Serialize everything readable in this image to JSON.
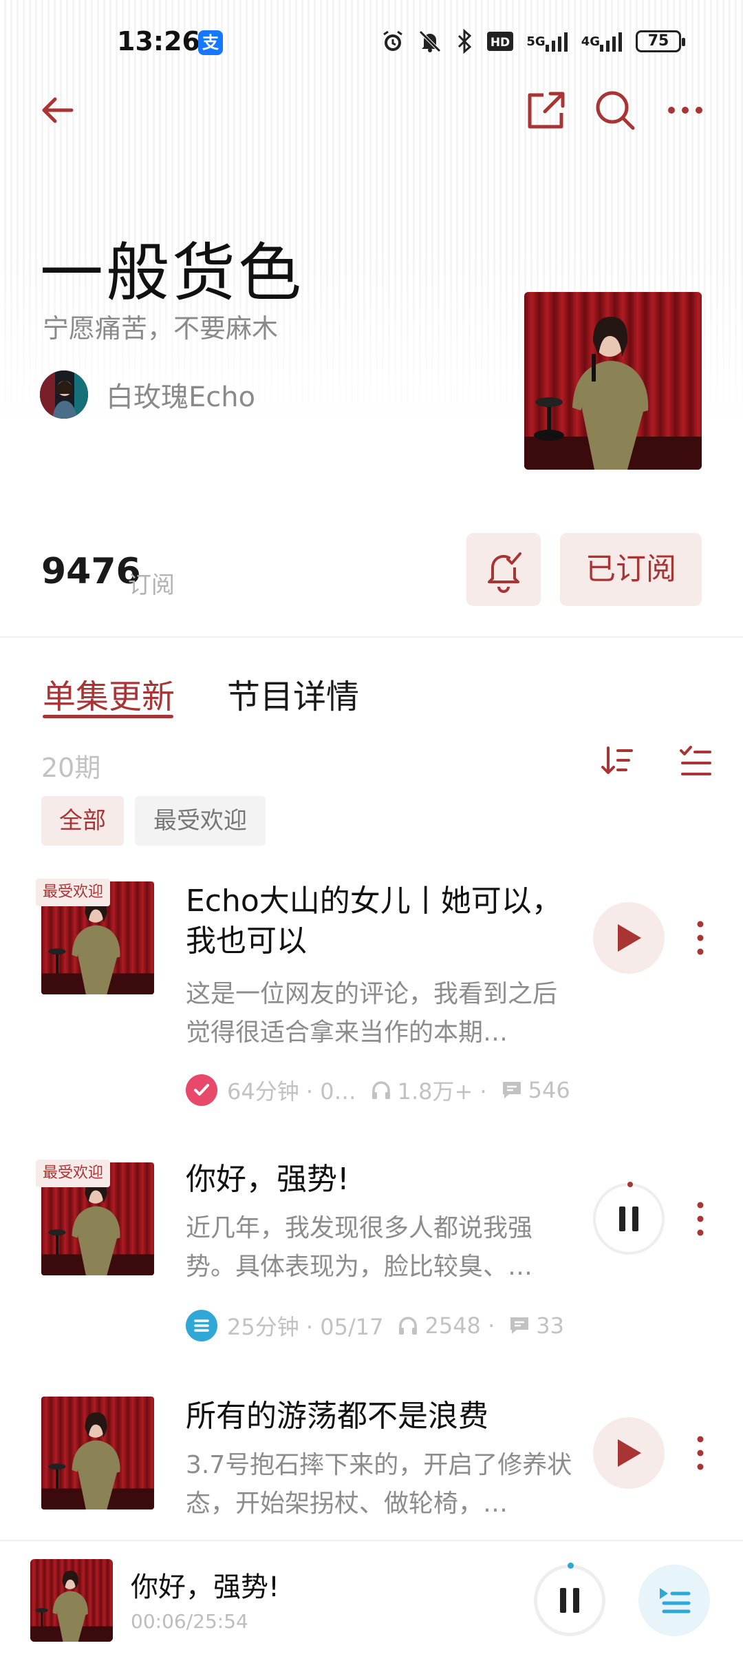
{
  "status_bar": {
    "time": "13:26",
    "alipay_glyph": "支",
    "network_5g": "5G",
    "network_4g": "4G",
    "hd_label": "HD",
    "battery": "75"
  },
  "podcast": {
    "title": "一般货色",
    "subtitle": "宁愿痛苦，不要麻木",
    "author": "白玫瑰Echo",
    "subscriber_count": "9476",
    "subscriber_label": "订阅",
    "subscribed_label": "已订阅"
  },
  "tabs": [
    {
      "label": "单集更新",
      "active": true
    },
    {
      "label": "节目详情",
      "active": false
    }
  ],
  "episode_count": "20期",
  "filters": [
    {
      "label": "全部",
      "active": true
    },
    {
      "label": "最受欢迎",
      "active": false
    }
  ],
  "episodes": [
    {
      "badge": "最受欢迎",
      "title": "Echo大山的女儿丨她可以，我也可以",
      "description": "这是一位网友的评论，我看到之后觉得很适合拿来当作的本期…",
      "status_icon": "check-circle-icon",
      "duration": "64分钟 · 0…",
      "plays": "1.8万+ ·",
      "comments": "546",
      "state": "play"
    },
    {
      "badge": "最受欢迎",
      "title": "你好，强势!",
      "description": "近几年，我发现很多人都说我强势。具体表现为，脸比较臭、…",
      "status_icon": "playlist-icon",
      "duration": "25分钟 · 05/17",
      "plays": "2548 ·",
      "comments": "33",
      "state": "pause"
    },
    {
      "badge": "",
      "title": "所有的游荡都不是浪费",
      "description": "3.7号抱石摔下来的，开启了修养状态，开始架拐杖、做轮椅，…",
      "state": "play"
    }
  ],
  "mini_player": {
    "title": "你好，强势!",
    "time": "00:06/25:54"
  },
  "colors": {
    "accent": "#a93434",
    "accent_bg": "#f7ebe9",
    "check_badge": "#e8486a",
    "list_badge": "#2fa8d8"
  }
}
